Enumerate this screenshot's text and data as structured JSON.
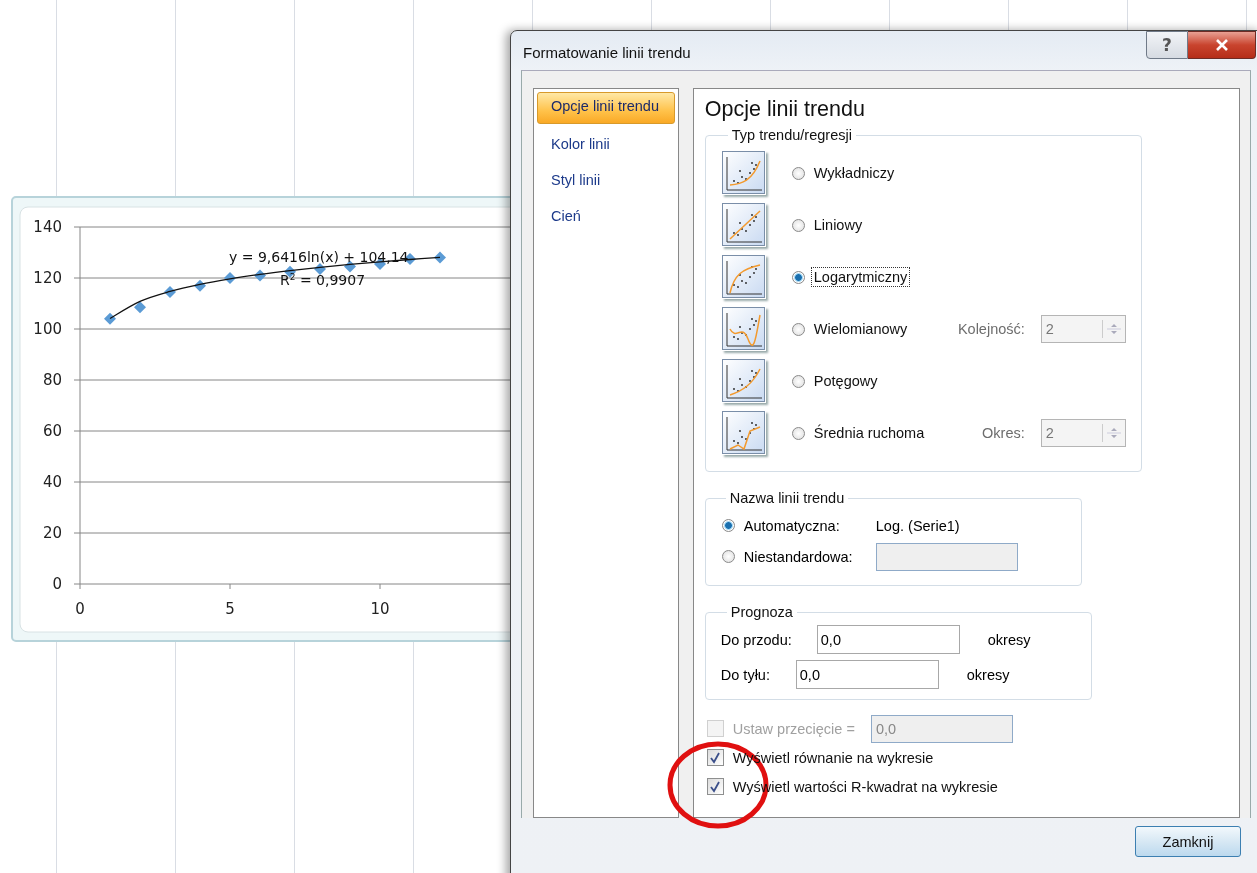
{
  "chart": {
    "chart_data": {
      "type": "scatter",
      "x": [
        1,
        2,
        3,
        4,
        5,
        6,
        7,
        8,
        9,
        10,
        11,
        12
      ],
      "xlim": [
        0,
        14.5
      ],
      "ylim": [
        0,
        140
      ],
      "xticks": [
        0,
        5,
        10
      ],
      "grid": true,
      "yticks": [
        0,
        20,
        40,
        60,
        80,
        100,
        120,
        140
      ],
      "series": [
        {
          "color": "#5b9bd5",
          "values": [
            104,
            108.5,
            114.5,
            117,
            120,
            121,
            122.5,
            123.5,
            124.5,
            125.5,
            127.5,
            128
          ]
        },
        {
          "type": "line",
          "color": "#111111",
          "values": [
            104.14,
            110.82,
            114.73,
            117.51,
            119.66,
            121.42,
            122.9,
            124.19,
            125.32,
            126.34,
            127.26,
            128.1
          ]
        }
      ],
      "annotations": [
        {
          "text": "y = 9,6416ln(x) + 104,14"
        },
        {
          "text": "R$^{2}$ = 0,9907"
        }
      ]
    }
  },
  "dialog": {
    "title": "Formatowanie linii trendu",
    "help_button": "?",
    "nav": [
      {
        "label": "Opcje linii trendu",
        "selected": true
      },
      {
        "label": "Kolor linii",
        "selected": false
      },
      {
        "label": "Styl linii",
        "selected": false
      },
      {
        "label": "Cień",
        "selected": false
      }
    ],
    "heading": "Opcje linii trendu",
    "trend_type": {
      "title": "Typ trendu/regresji",
      "options": [
        {
          "kind": "exponential",
          "label": "Wykładniczy",
          "selected": false
        },
        {
          "kind": "linear",
          "label": "Liniowy",
          "selected": false
        },
        {
          "kind": "logarithmic",
          "label": "Logarytmiczny",
          "selected": true
        },
        {
          "kind": "polynomial",
          "label": "Wielomianowy",
          "selected": false,
          "param": {
            "label": "Kolejność:",
            "value": "2",
            "disabled": true
          }
        },
        {
          "kind": "power",
          "label": "Potęgowy",
          "selected": false
        },
        {
          "kind": "moving_average",
          "label": "Średnia ruchoma",
          "selected": false,
          "param": {
            "label": "Okres:",
            "value": "2",
            "disabled": true
          }
        }
      ]
    },
    "trend_name": {
      "title": "Nazwa linii trendu",
      "options": [
        {
          "label": "Automatyczna:",
          "selected": true,
          "value": "Log. (Serie1)"
        },
        {
          "label": "Niestandardowa:",
          "selected": false,
          "field": {
            "disabled": true
          }
        }
      ]
    },
    "forecast": {
      "title": "Prognoza",
      "rows": [
        {
          "label": "Do przodu:",
          "value": "0,0",
          "unit": "okresy"
        },
        {
          "label": "Do tyłu:",
          "value": "0,0",
          "unit": "okresy"
        }
      ]
    },
    "checkboxes": [
      {
        "label": "Ustaw przecięcie =",
        "checked": false,
        "disabled": true,
        "value": "0,0"
      },
      {
        "label": "Wyświetl równanie na wykresie",
        "checked": true,
        "disabled": false
      },
      {
        "label": "Wyświetl wartości R-kwadrat na wykresie",
        "checked": true,
        "disabled": false
      }
    ],
    "close_button": "Zamknij"
  }
}
